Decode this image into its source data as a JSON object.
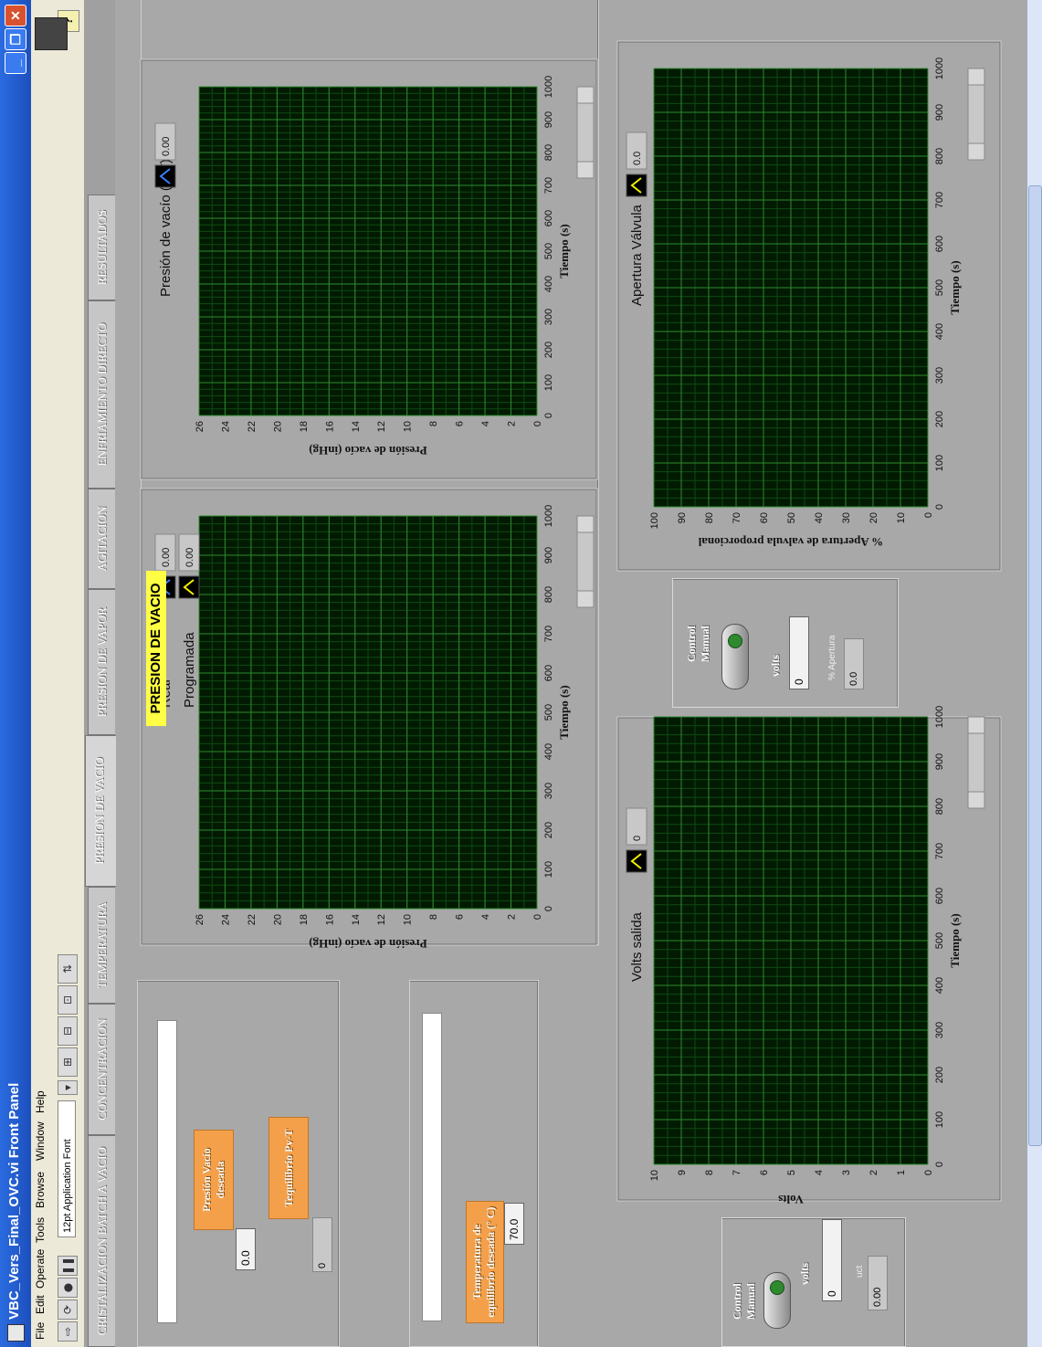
{
  "window": {
    "title": "VBC_Vers_Final_OVC.vi Front Panel"
  },
  "menu": [
    "File",
    "Edit",
    "Operate",
    "Tools",
    "Browse",
    "Window",
    "Help"
  ],
  "toolbar": {
    "font": "12pt Application Font",
    "help": "?"
  },
  "tabs": [
    {
      "label": "CRISTALIZACION BATCH A VACIO"
    },
    {
      "label": "CONCENTRACION"
    },
    {
      "label": "TEMPERATURA"
    },
    {
      "label": "PRESION DE VACIO",
      "active": true
    },
    {
      "label": "PRESION DE VAPOR"
    },
    {
      "label": "AGITACION"
    },
    {
      "label": "ENFRIAMIENTO DIRECTO"
    },
    {
      "label": "RESULTADOS"
    }
  ],
  "left_controls": {
    "presion_label": "Presión Vacío deseada",
    "presion_value": "0.0",
    "equilibrio_label": "Tequilibrio Pv-T",
    "equilibrio_value": "0",
    "temperatura_label": "Temperatura de equilibrio deseada (° C)",
    "temperatura_value": "70.0"
  },
  "graph1": {
    "title_label": "PRESION DE VACIO",
    "legend": [
      {
        "name": "Real",
        "value": "0.00"
      },
      {
        "name": "Programada",
        "value": "0.00"
      }
    ],
    "xlabel": "Tiempo (s)",
    "ylabel": "Presión de vacío (inHg)",
    "xticks": [
      "0",
      "100",
      "200",
      "300",
      "400",
      "500",
      "600",
      "700",
      "800",
      "900",
      "1000"
    ],
    "yticks": [
      "0",
      "2",
      "4",
      "6",
      "8",
      "10",
      "12",
      "14",
      "16",
      "18",
      "20",
      "22",
      "24",
      "26"
    ]
  },
  "graph2": {
    "legend": [
      {
        "name": "Presión de vacío (C-T)",
        "value": "0.00"
      }
    ],
    "xlabel": "Tiempo (s)",
    "ylabel": "Presión de vacío (inHg)",
    "xticks": [
      "0",
      "100",
      "200",
      "300",
      "400",
      "500",
      "600",
      "700",
      "800",
      "900",
      "1000"
    ],
    "yticks": [
      "0",
      "2",
      "4",
      "6",
      "8",
      "10",
      "12",
      "14",
      "16",
      "18",
      "20",
      "22",
      "24",
      "26"
    ]
  },
  "graph3": {
    "legend": [
      {
        "name": "Volts salida",
        "value": "0"
      }
    ],
    "xlabel": "Tiempo (s)",
    "ylabel": "Volts",
    "xticks": [
      "0",
      "100",
      "200",
      "300",
      "400",
      "500",
      "600",
      "700",
      "800",
      "900",
      "1000"
    ],
    "yticks": [
      "0",
      "1",
      "2",
      "3",
      "4",
      "5",
      "6",
      "7",
      "8",
      "9",
      "10"
    ]
  },
  "graph4": {
    "legend": [
      {
        "name": "Apertura Válvula",
        "value": "0.0"
      }
    ],
    "xlabel": "Tiempo (s)",
    "ylabel": "% Apertura de valvula proporcional",
    "xticks": [
      "0",
      "100",
      "200",
      "300",
      "400",
      "500",
      "600",
      "700",
      "800",
      "900",
      "1000"
    ],
    "yticks": [
      "0",
      "10",
      "20",
      "30",
      "40",
      "50",
      "60",
      "70",
      "80",
      "90",
      "100"
    ]
  },
  "control_box1": {
    "title": "Control Manual",
    "volts_label": "volts",
    "volts_value": "0",
    "unit_label": "uct",
    "unit_value": "0.00"
  },
  "control_box2": {
    "title": "Control Manual",
    "volts_label": "volts",
    "volts_value": "0",
    "pct_label": "% Apertura",
    "pct_value": "0.0"
  },
  "colors": {
    "plot_bg": "#021a02",
    "grid_major": "#2e8a2e",
    "grid_minor": "#0f4a12",
    "orange_label": "#f4a04a",
    "yellow_label": "#ffff44",
    "series_real": "#3a7bff",
    "series_prog": "#f0f000"
  }
}
